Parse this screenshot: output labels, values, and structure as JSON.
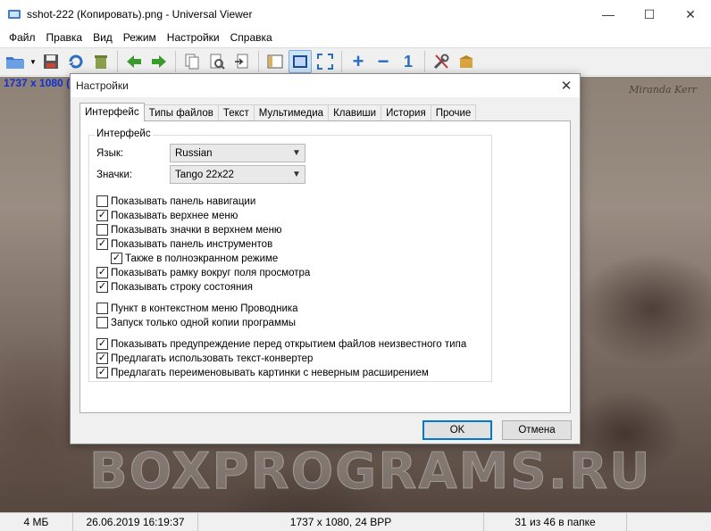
{
  "window": {
    "title": "sshot-222 (Копировать).png - Universal Viewer",
    "minimize": "—",
    "maximize": "☐",
    "close": "✕"
  },
  "menu": [
    "Файл",
    "Правка",
    "Вид",
    "Режим",
    "Настройки",
    "Справка"
  ],
  "viewer": {
    "image_info": "1737 x 1080 (",
    "watermark": "BOXPROGRAMS.RU",
    "signature": "Miranda Kerr"
  },
  "status": {
    "size": "4 МБ",
    "date": "26.06.2019 16:19:37",
    "dimensions": "1737 x 1080, 24 BPP",
    "position": "31 из 46 в папке"
  },
  "dialog": {
    "title": "Настройки",
    "close": "✕",
    "tabs": [
      "Интерфейс",
      "Типы файлов",
      "Текст",
      "Мультимедиа",
      "Клавиши",
      "История",
      "Прочие"
    ],
    "group_label": "Интерфейс",
    "language_label": "Язык:",
    "language_value": "Russian",
    "icons_label": "Значки:",
    "icons_value": "Tango 22x22",
    "checkboxes": [
      {
        "label": "Показывать панель навигации",
        "checked": false
      },
      {
        "label": "Показывать верхнее меню",
        "checked": true
      },
      {
        "label": "Показывать значки в верхнем меню",
        "checked": false
      },
      {
        "label": "Показывать панель инструментов",
        "checked": true
      },
      {
        "label": "Также в полноэкранном режиме",
        "checked": true
      },
      {
        "label": "Показывать рамку вокруг поля просмотра",
        "checked": true
      },
      {
        "label": "Показывать строку состояния",
        "checked": true
      },
      {
        "label": "Пункт в контекстном меню Проводника",
        "checked": false
      },
      {
        "label": "Запуск только одной копии программы",
        "checked": false
      },
      {
        "label": "Показывать предупреждение перед открытием файлов неизвестного типа",
        "checked": true
      },
      {
        "label": "Предлагать использовать текст-конвертер",
        "checked": true
      },
      {
        "label": "Предлагать переименовывать картинки с неверным расширением",
        "checked": true
      }
    ],
    "ok_label": "OK",
    "cancel_label": "Отмена"
  },
  "colors": {
    "accent": "#0078d7",
    "image_info": "#1030d0"
  }
}
